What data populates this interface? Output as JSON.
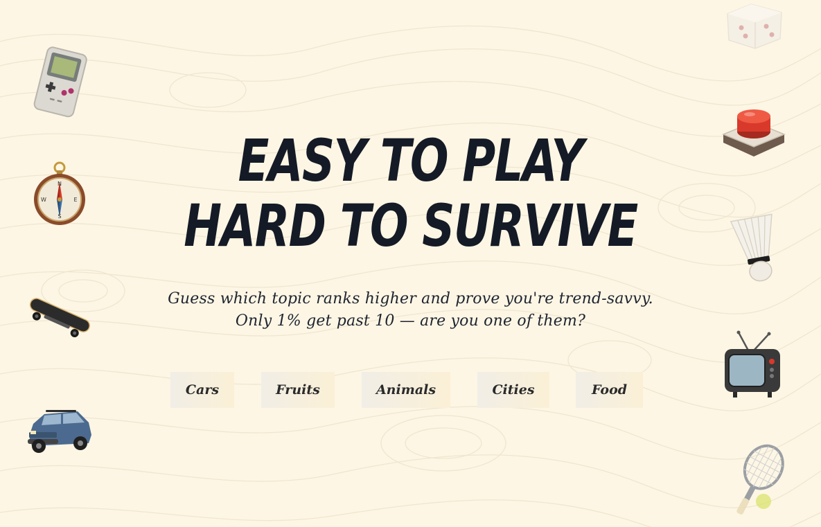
{
  "hero": {
    "headline_line1": "EASY TO PLAY",
    "headline_line2": "HARD TO SURVIVE",
    "subtitle_line1": "Guess which topic ranks higher and prove you're trend-savvy.",
    "subtitle_line2": "Only 1% get past 10 — are you one of them?"
  },
  "topics": [
    {
      "label": "Cars"
    },
    {
      "label": "Fruits"
    },
    {
      "label": "Animals"
    },
    {
      "label": "Cities"
    },
    {
      "label": "Food"
    }
  ],
  "decorations": {
    "left": [
      "game-console-icon",
      "compass-icon",
      "skateboard-icon",
      "suv-car-icon"
    ],
    "right": [
      "dice-icon",
      "red-button-icon",
      "shuttlecock-icon",
      "retro-tv-icon",
      "tennis-racket-icon"
    ]
  },
  "colors": {
    "background": "#fdf6e4",
    "headline": "#141a26",
    "text": "#1d2330",
    "chip_bg": "#f1eee6"
  }
}
